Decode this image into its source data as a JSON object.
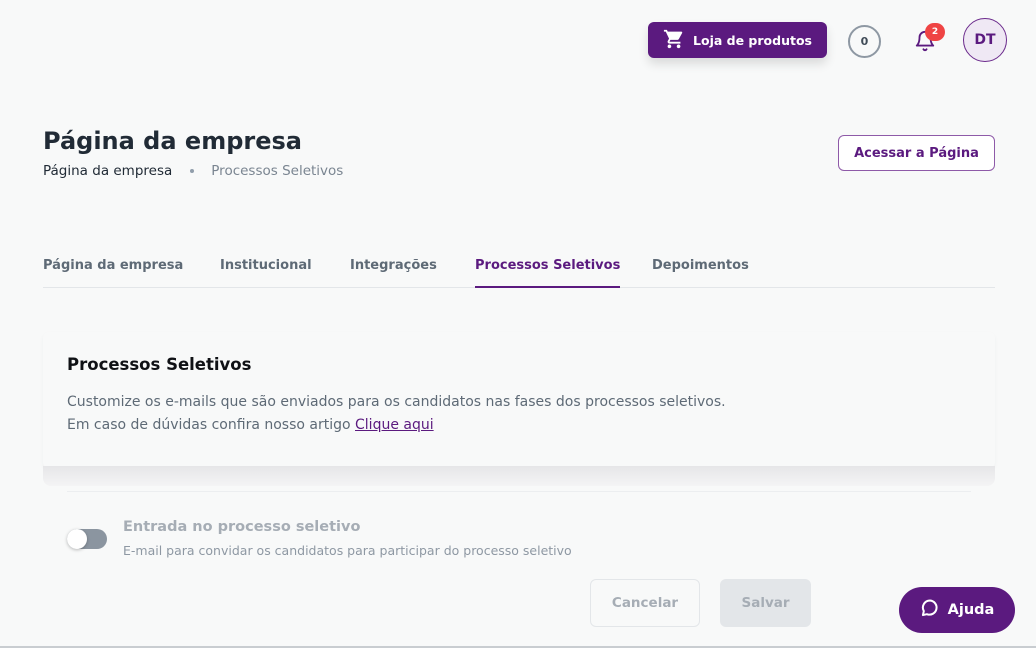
{
  "topbar": {
    "shop_button_label": "Loja de produtos",
    "coins": "0",
    "notifications_count": "2",
    "avatar_initials": "DT"
  },
  "header": {
    "title": "Página da empresa",
    "breadcrumb": [
      "Página da empresa",
      "Processos Seletivos"
    ],
    "access_button_label": "Acessar a Página"
  },
  "tabs": [
    {
      "label": "Página da empresa",
      "active": false
    },
    {
      "label": "Institucional",
      "active": false
    },
    {
      "label": "Integrações",
      "active": false
    },
    {
      "label": "Processos Seletivos",
      "active": true
    },
    {
      "label": "Depoimentos",
      "active": false
    }
  ],
  "section": {
    "title": "Processos Seletivos",
    "description_line1": "Customize os e-mails que são enviados para os candidatos nas fases dos processos seletivos.",
    "description_line2_prefix": "Em caso de dúvidas confira nosso artigo ",
    "link_label": "Clique aqui"
  },
  "settings": [
    {
      "title": "Entrada no processo seletivo",
      "description": "E-mail para convidar os candidatos para participar do processo seletivo",
      "enabled": false
    }
  ],
  "actions": {
    "cancel_label": "Cancelar",
    "save_label": "Salvar"
  },
  "help": {
    "label": "Ajuda"
  },
  "colors": {
    "brand": "#5b1a7f",
    "badge": "#ef4444",
    "background": "#f8f9f9"
  },
  "icons": [
    "cart-icon",
    "bell-icon",
    "chat-icon"
  ]
}
